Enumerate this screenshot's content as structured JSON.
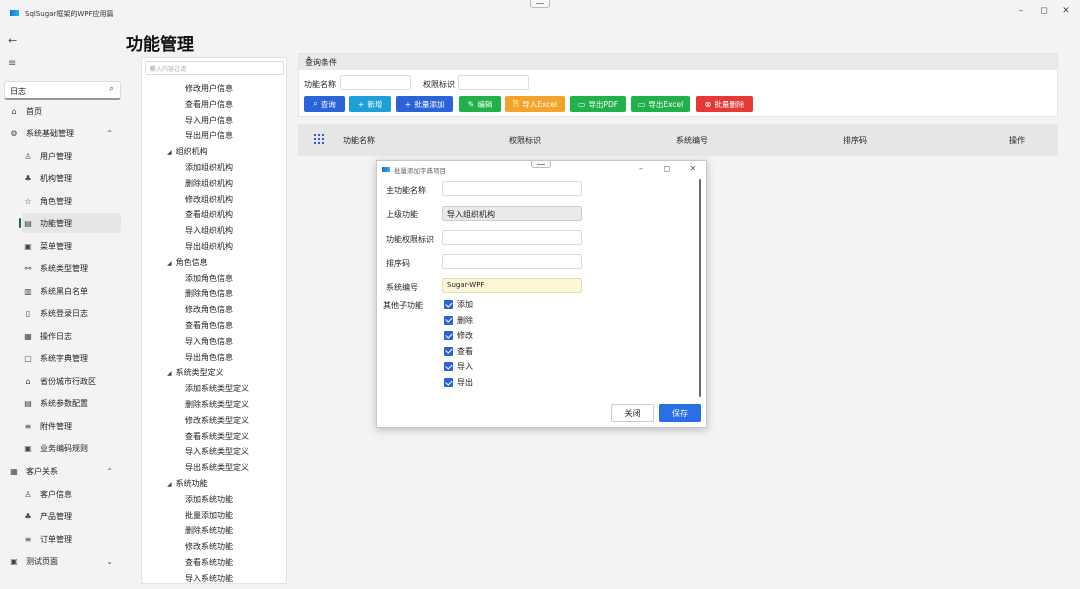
{
  "window": {
    "title": "SqlSugar框架的WPF应用篇",
    "minimize": "–",
    "maximize": "◻",
    "close": "✕"
  },
  "page": {
    "title": "功能管理"
  },
  "nav": {
    "search_value": "日志",
    "items": [
      {
        "label": "首页",
        "icon": "home-icon",
        "glyph": "⌂"
      },
      {
        "label": "系统基础管理",
        "icon": "settings-icon",
        "glyph": "⚙"
      },
      {
        "label": "用户管理",
        "icon": "user-icon",
        "glyph": "♙"
      },
      {
        "label": "机构管理",
        "icon": "org-icon",
        "glyph": "♣"
      },
      {
        "label": "角色管理",
        "icon": "role-icon",
        "glyph": "☆"
      },
      {
        "label": "功能管理",
        "icon": "function-icon",
        "glyph": "▤"
      },
      {
        "label": "菜单管理",
        "icon": "menu-list-icon",
        "glyph": "▣"
      },
      {
        "label": "系统类型管理",
        "icon": "type-icon",
        "glyph": "⚯"
      },
      {
        "label": "系统黑白名单",
        "icon": "blacklist-icon",
        "glyph": "▥"
      },
      {
        "label": "系统登录日志",
        "icon": "login-log-icon",
        "glyph": "▯"
      },
      {
        "label": "操作日志",
        "icon": "operation-log-icon",
        "glyph": "▦"
      },
      {
        "label": "系统字典管理",
        "icon": "dictionary-icon",
        "glyph": "▢"
      },
      {
        "label": "省份城市行政区",
        "icon": "region-icon",
        "glyph": "⌂"
      },
      {
        "label": "系统参数配置",
        "icon": "param-icon",
        "glyph": "▤"
      },
      {
        "label": "附件管理",
        "icon": "attachment-icon",
        "glyph": "≡"
      },
      {
        "label": "业务编码规则",
        "icon": "code-rule-icon",
        "glyph": "▣"
      },
      {
        "label": "客户关系",
        "icon": "customer-relation-icon",
        "glyph": "▦"
      },
      {
        "label": "客户信息",
        "icon": "customer-icon",
        "glyph": "♙"
      },
      {
        "label": "产品管理",
        "icon": "product-icon",
        "glyph": "♣"
      },
      {
        "label": "订单管理",
        "icon": "order-icon",
        "glyph": "≡"
      },
      {
        "label": "测试页面",
        "icon": "test-page-icon",
        "glyph": "▣"
      }
    ]
  },
  "tree": {
    "placeholder": "输入内容过滤",
    "nodes": [
      {
        "label": "修改用户信息",
        "group": false
      },
      {
        "label": "查看用户信息",
        "group": false
      },
      {
        "label": "导入用户信息",
        "group": false
      },
      {
        "label": "导出用户信息",
        "group": false
      },
      {
        "label": "组织机构",
        "group": true
      },
      {
        "label": "添加组织机构",
        "group": false
      },
      {
        "label": "删除组织机构",
        "group": false
      },
      {
        "label": "修改组织机构",
        "group": false
      },
      {
        "label": "查看组织机构",
        "group": false
      },
      {
        "label": "导入组织机构",
        "group": false
      },
      {
        "label": "导出组织机构",
        "group": false
      },
      {
        "label": "角色信息",
        "group": true
      },
      {
        "label": "添加角色信息",
        "group": false
      },
      {
        "label": "删除角色信息",
        "group": false
      },
      {
        "label": "修改角色信息",
        "group": false
      },
      {
        "label": "查看角色信息",
        "group": false
      },
      {
        "label": "导入角色信息",
        "group": false
      },
      {
        "label": "导出角色信息",
        "group": false
      },
      {
        "label": "系统类型定义",
        "group": true
      },
      {
        "label": "添加系统类型定义",
        "group": false
      },
      {
        "label": "删除系统类型定义",
        "group": false
      },
      {
        "label": "修改系统类型定义",
        "group": false
      },
      {
        "label": "查看系统类型定义",
        "group": false
      },
      {
        "label": "导入系统类型定义",
        "group": false
      },
      {
        "label": "导出系统类型定义",
        "group": false
      },
      {
        "label": "系统功能",
        "group": true
      },
      {
        "label": "添加系统功能",
        "group": false
      },
      {
        "label": "批量添加功能",
        "group": false
      },
      {
        "label": "删除系统功能",
        "group": false
      },
      {
        "label": "修改系统功能",
        "group": false
      },
      {
        "label": "查看系统功能",
        "group": false
      },
      {
        "label": "导入系统功能",
        "group": false
      }
    ]
  },
  "query": {
    "header": "查询条件",
    "name_label": "功能名称",
    "perm_label": "权限标识",
    "buttons": [
      {
        "label": "查询",
        "icon": "search-icon",
        "glyph": "⌕",
        "color": "#2b63d9"
      },
      {
        "label": "新增",
        "icon": "plus-icon",
        "glyph": "+",
        "color": "#1e9fd8"
      },
      {
        "label": "批量添加",
        "icon": "batch-add-icon",
        "glyph": "+",
        "color": "#2b63d9"
      },
      {
        "label": "编辑",
        "icon": "edit-icon",
        "glyph": "✎",
        "color": "#22b04b"
      },
      {
        "label": "导入Excel",
        "icon": "import-icon",
        "glyph": "⎘",
        "color": "#f2a32a"
      },
      {
        "label": "导出PDF",
        "icon": "export-pdf-icon",
        "glyph": "▭",
        "color": "#22b04b"
      },
      {
        "label": "导出Excel",
        "icon": "export-excel-icon",
        "glyph": "▭",
        "color": "#22b04b"
      },
      {
        "label": "批量删除",
        "icon": "delete-icon",
        "glyph": "⊗",
        "color": "#e53935"
      }
    ]
  },
  "grid": {
    "columns": [
      "功能名称",
      "权限标识",
      "系统编号",
      "排序码",
      "操作"
    ]
  },
  "dialog": {
    "title": "批量添加字典项目",
    "labels": {
      "main_name": "主功能名称",
      "parent": "上级功能",
      "perm": "功能权限标识",
      "sort": "排序码",
      "system_code": "系统编号",
      "sub_functions": "其他子功能"
    },
    "parent_value": "导入组织机构",
    "system_code_value": "Sugar-WPF",
    "checkboxes": [
      "添加",
      "删除",
      "修改",
      "查看",
      "导入",
      "导出"
    ],
    "close_label": "关闭",
    "save_label": "保存",
    "accent": "#2b6ee6"
  }
}
